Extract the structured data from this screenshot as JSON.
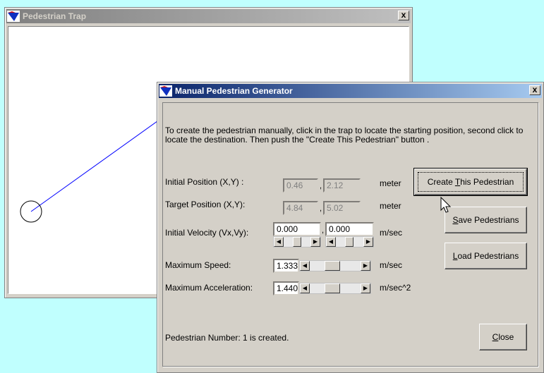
{
  "trap_window": {
    "title": "Pedestrian Trap",
    "close_label": "x"
  },
  "generator": {
    "title": "Manual Pedestrian Generator",
    "close_label": "x",
    "instructions": "To create the pedestrian manually, click in the trap to locate the starting position, second click to locate the destination. Then push the \"Create This Pedestrian\" button .",
    "initial_position": {
      "label": "Initial Position (X,Y) :",
      "x": "0.46",
      "y": "2.12",
      "unit": "meter"
    },
    "target_position": {
      "label": "Target Position (X,Y):",
      "x": "4.84",
      "y": "5.02",
      "unit": "meter"
    },
    "initial_velocity": {
      "label": "Initial Velocity (Vx,Vy):",
      "vx": "0.000",
      "vy": "0.000",
      "unit": "m/sec"
    },
    "max_speed": {
      "label": "Maximum Speed:",
      "value": "1.333",
      "unit": "m/sec"
    },
    "max_acceleration": {
      "label": "Maximum Acceleration:",
      "value": "1.440",
      "unit": "m/sec^2"
    },
    "comma": ",",
    "buttons": {
      "create": {
        "u": "T",
        "rest_before": "Create ",
        "rest_after": "his Pedestrian"
      },
      "save": {
        "u": "S",
        "rest_after": "ave Pedestrians"
      },
      "load": {
        "u": "L",
        "rest_after": "oad Pedestrians"
      },
      "close": {
        "u": "C",
        "rest_after": "lose"
      }
    },
    "status": "Pedestrian Number: 1 is created."
  },
  "icons": [
    "app-icon",
    "close-icon",
    "scroll-left-icon",
    "scroll-right-icon",
    "mouse-cursor-icon"
  ],
  "colors": {
    "active_title": "#0a246a",
    "inactive_title": "#808080",
    "desktop": "#c0fffe",
    "path_line": "#0000ff"
  }
}
